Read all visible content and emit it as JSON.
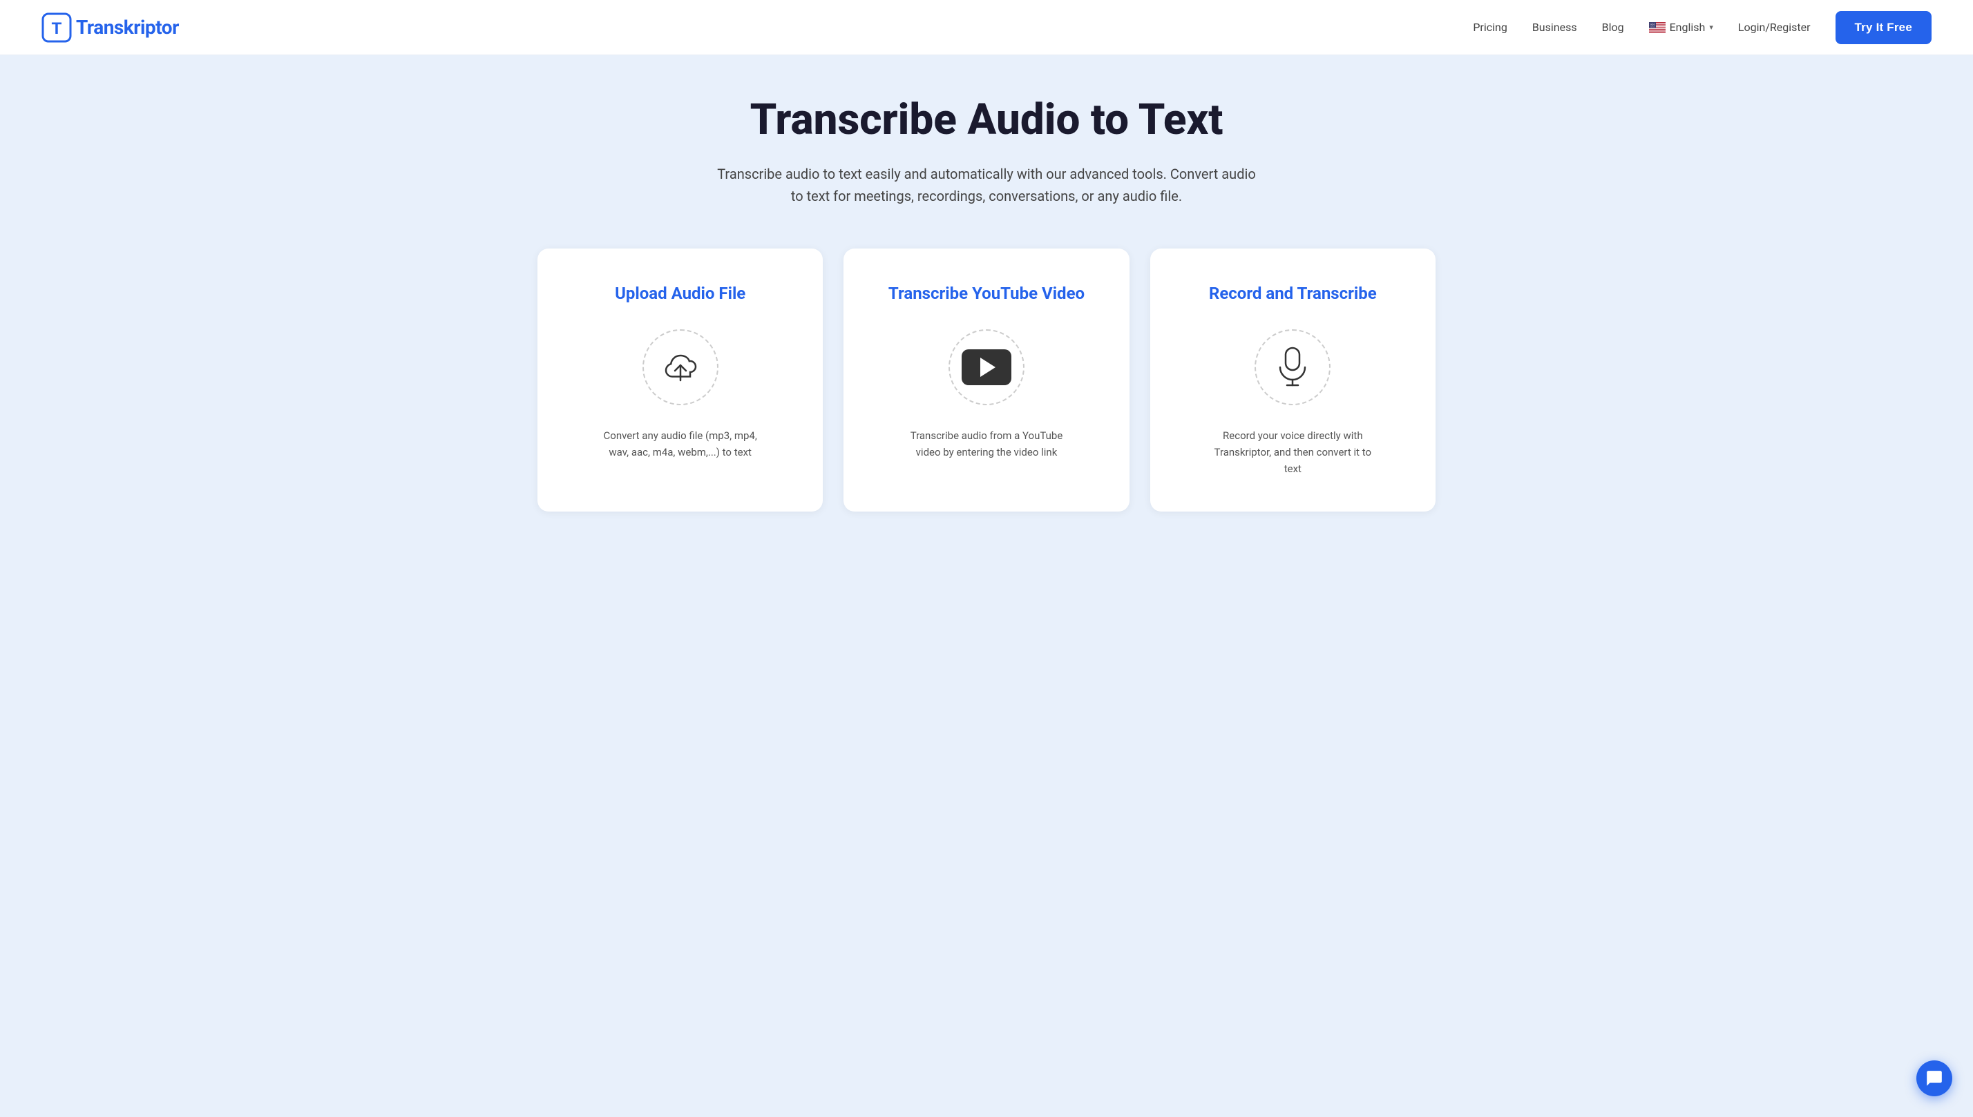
{
  "header": {
    "logo_text_pre": "",
    "logo_letter": "T",
    "logo_name": "ranskriptor",
    "nav": {
      "pricing": "Pricing",
      "business": "Business",
      "blog": "Blog",
      "language": "English",
      "login": "Login/Register",
      "try_free": "Try It Free"
    }
  },
  "hero": {
    "title": "Transcribe Audio to Text",
    "subtitle": "Transcribe audio to text easily and automatically with our advanced tools. Convert audio to text for meetings, recordings, conversations, or any audio file."
  },
  "cards": [
    {
      "id": "upload",
      "title": "Upload Audio File",
      "description": "Convert any audio file (mp3, mp4, wav, aac, m4a, webm,...) to text",
      "icon": "upload-cloud-icon"
    },
    {
      "id": "youtube",
      "title": "Transcribe YouTube Video",
      "description": "Transcribe audio from a YouTube video by entering the video link",
      "icon": "youtube-play-icon"
    },
    {
      "id": "record",
      "title": "Record and Transcribe",
      "description": "Record your voice directly with Transkriptor, and then convert it to text",
      "icon": "microphone-icon"
    }
  ],
  "colors": {
    "brand_blue": "#2563eb",
    "bg_light": "#e8f0fb",
    "white": "#ffffff",
    "text_dark": "#1a1a2e",
    "text_mid": "#444444",
    "text_light": "#555555"
  }
}
